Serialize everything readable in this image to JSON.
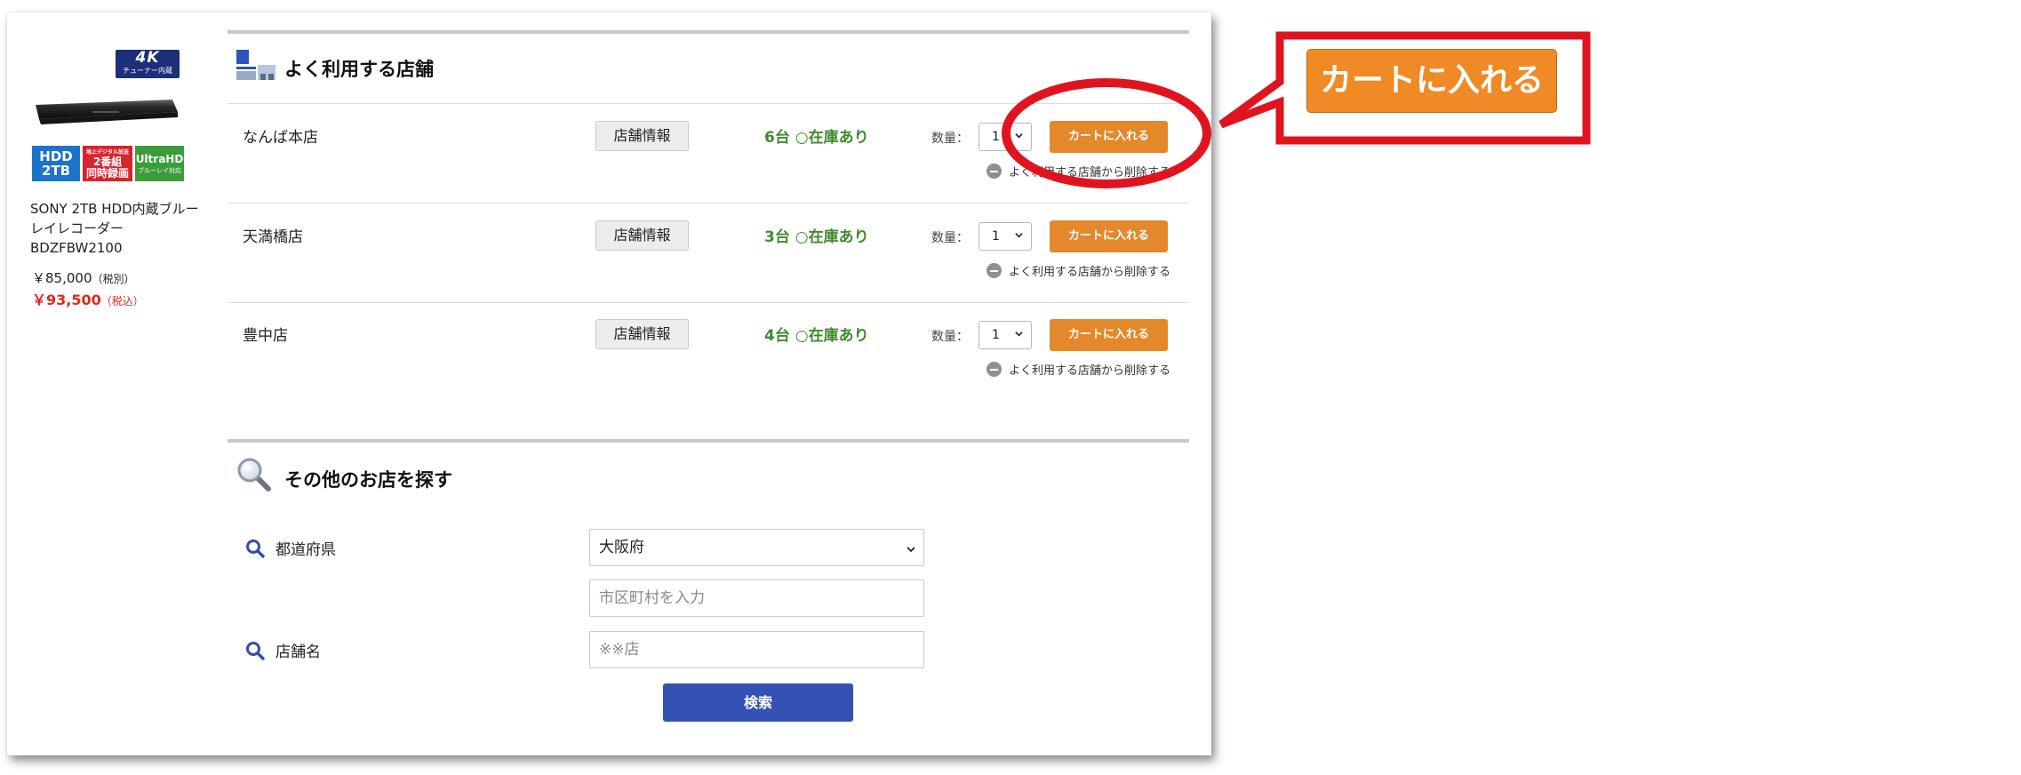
{
  "product": {
    "badge_4k_main": "4K",
    "badge_4k_sub": "チューナー内蔵",
    "spec_hdd_line1": "HDD",
    "spec_hdd_line2": "2TB",
    "spec_ban_top": "地上デジタル放送",
    "spec_ban_mid": "2番組",
    "spec_ban_bottom": "同時録画",
    "spec_uhd_main": "UltraHD",
    "spec_uhd_sub": "ブルーレイ対応",
    "name": "SONY 2TB HDD内蔵ブルーレイレコーダー BDZFBW2100",
    "price_ex": "￥85,000",
    "price_ex_note": "（税別）",
    "price_in": "￥93,500",
    "price_in_note": "（税込）"
  },
  "favorites": {
    "title": "よく利用する店舗",
    "info_label": "店舗情報",
    "qty_label": "数量：",
    "cart_label": "カートに入れる",
    "remove_label": "よく利用する店舗から削除する",
    "stores": [
      {
        "name": "なんば本店",
        "stock": "6台 ○在庫あり",
        "qty": "1"
      },
      {
        "name": "天満橋店",
        "stock": "3台 ○在庫あり",
        "qty": "1"
      },
      {
        "name": "豊中店",
        "stock": "4台 ○在庫あり",
        "qty": "1"
      }
    ]
  },
  "search": {
    "title": "その他のお店を探す",
    "prefecture_label": "都道府県",
    "prefecture_value": "大阪府",
    "city_placeholder": "市区町村を入力",
    "store_label": "店舗名",
    "store_placeholder": "※※店",
    "submit_label": "検索"
  },
  "callout": {
    "button_label": "カートに入れる"
  },
  "colors": {
    "cart_orange": "#e3882b",
    "stock_green": "#3f8a2e",
    "search_blue": "#3352b4",
    "price_red": "#e0281b",
    "annotation_red": "#e0141e"
  }
}
